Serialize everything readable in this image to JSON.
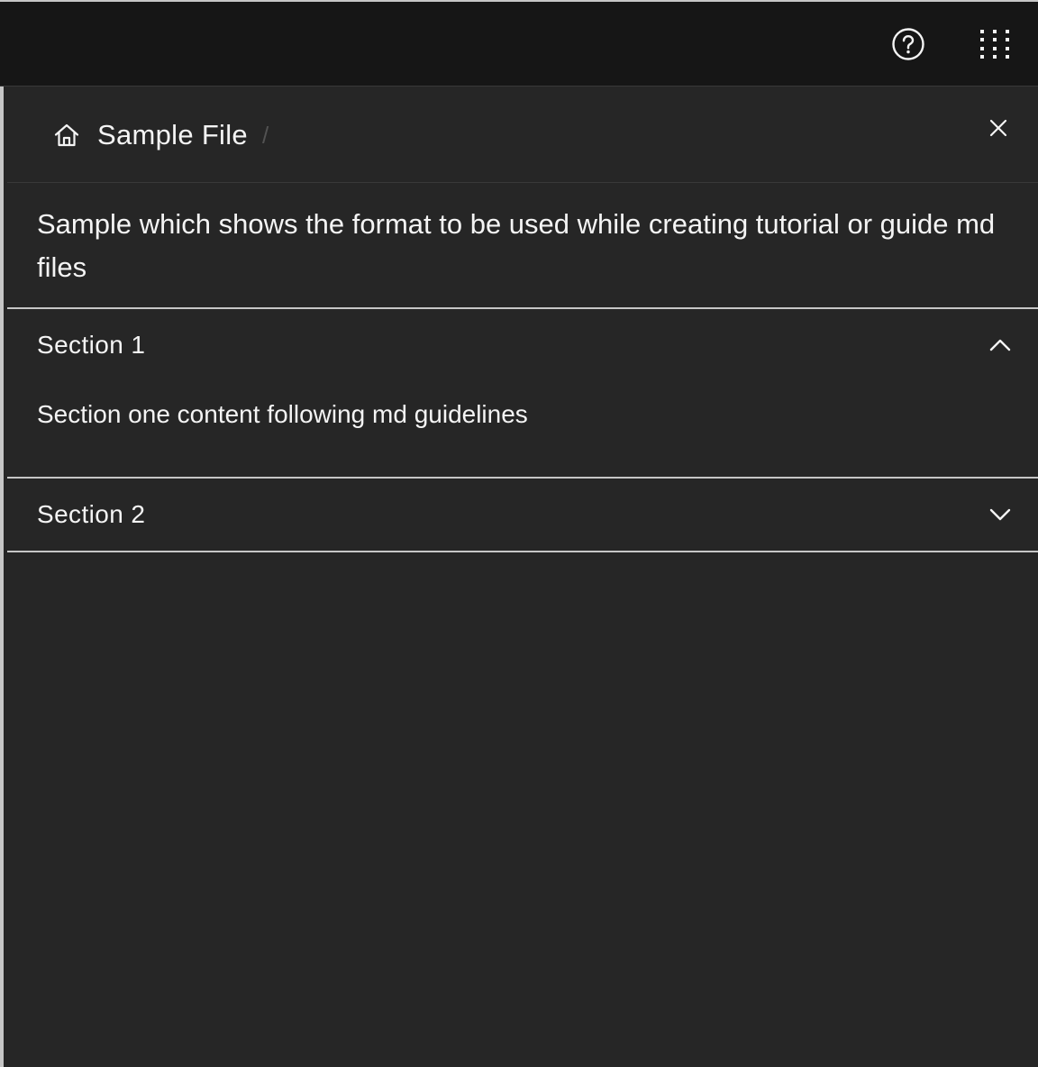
{
  "header": {
    "help_icon": "help-icon",
    "switcher_icon": "app-switcher-icon"
  },
  "panel": {
    "breadcrumb": {
      "home_icon": "home-icon",
      "title": "Sample File",
      "separator": "/"
    },
    "close_icon": "close-icon",
    "description": "Sample which shows the format to be used while creating tutorial or guide md files",
    "sections": [
      {
        "title": "Section 1",
        "expanded": true,
        "content": "Section one content following md guidelines"
      },
      {
        "title": "Section 2",
        "expanded": false,
        "content": ""
      }
    ]
  },
  "colors": {
    "header_bg": "#161616",
    "panel_bg": "#262626",
    "text": "#f4f4f4",
    "divider": "#c6c6c6"
  }
}
